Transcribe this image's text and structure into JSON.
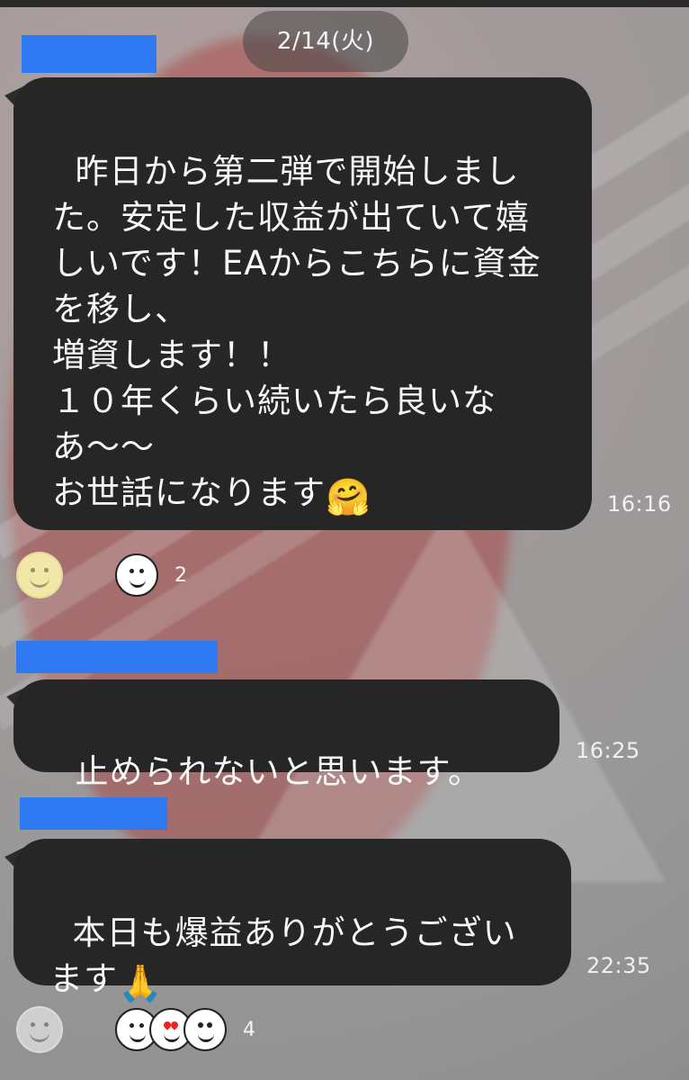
{
  "date_divider": "2/14(火)",
  "messages": [
    {
      "text": "昨日から第二弾で開始しました。安定した収益が出ていて嬉しいです！EAからこちらに資金を移し、\n増資します！！\n１０年くらい続いたら良いなあ〜〜\nお世話になります",
      "emoji": "🤗",
      "time": "16:16",
      "reactions": {
        "count": "2"
      }
    },
    {
      "text": "止められないと思います。",
      "time": "16:25"
    },
    {
      "text": "本日も爆益ありがとうございます",
      "emoji": "🙏",
      "time": "22:35",
      "reactions": {
        "count": "4"
      }
    }
  ],
  "colors": {
    "bubble": "#262626",
    "name_bar": "#2f7af3",
    "text": "#f7f7f7",
    "time": "#f0f0f0"
  }
}
